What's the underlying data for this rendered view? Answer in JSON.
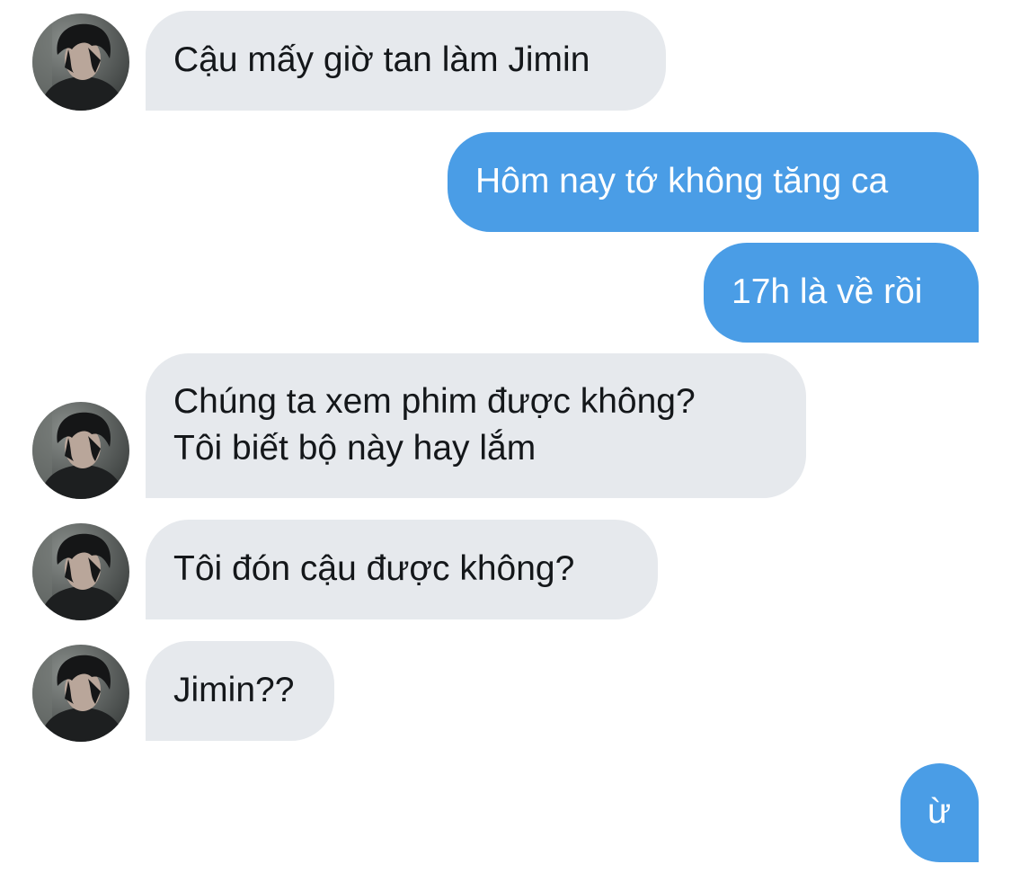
{
  "conversation": {
    "messages": [
      {
        "sender": "contact",
        "lines": [
          "Cậu mấy giờ tan làm Jimin"
        ]
      },
      {
        "sender": "me",
        "lines": [
          "Hôm nay tớ không tăng ca"
        ]
      },
      {
        "sender": "me",
        "lines": [
          "17h là về rồi"
        ]
      },
      {
        "sender": "contact",
        "lines": [
          "Chúng ta xem phim được không?",
          "Tôi biết bộ này hay lắm"
        ]
      },
      {
        "sender": "contact",
        "lines": [
          "Tôi đón cậu được không?"
        ]
      },
      {
        "sender": "contact",
        "lines": [
          "Jimin??"
        ]
      },
      {
        "sender": "me",
        "lines": [
          "ừ"
        ]
      }
    ]
  },
  "colors": {
    "incoming_bubble": "#e6e9ed",
    "outgoing_bubble": "#4a9de6",
    "incoming_text": "#14171a",
    "outgoing_text": "#ffffff"
  }
}
